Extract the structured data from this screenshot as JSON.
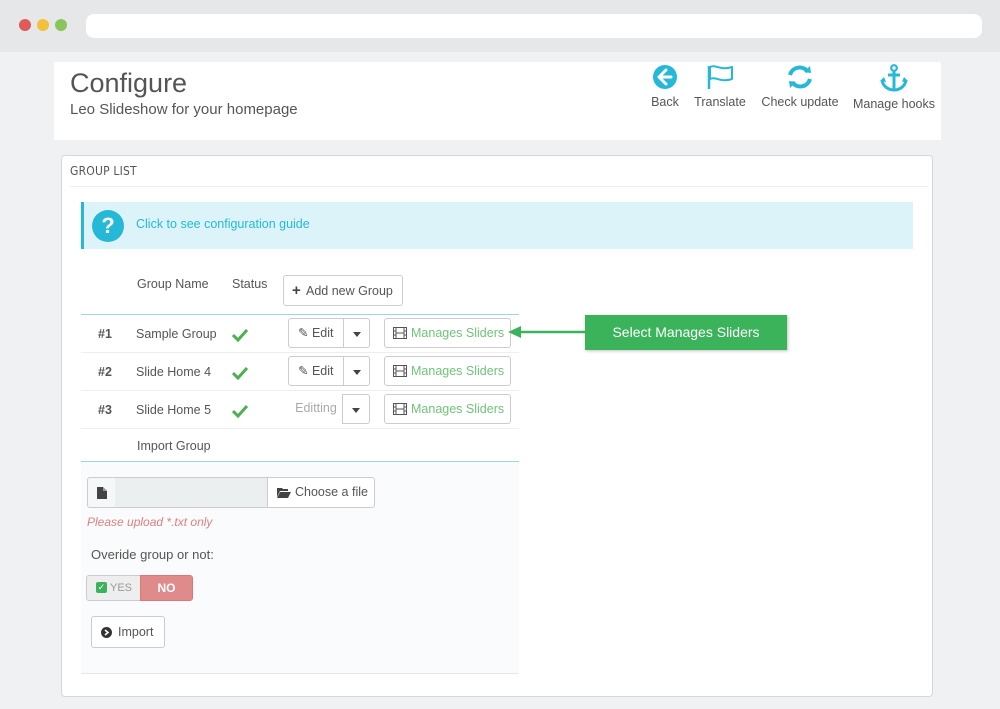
{
  "header": {
    "title": "Configure",
    "subtitle": "Leo Slideshow for your homepage",
    "toolbar": [
      {
        "label": "Back",
        "icon": "back-arrow-circle-icon"
      },
      {
        "label": "Translate",
        "icon": "flag-icon"
      },
      {
        "label": "Check update",
        "icon": "refresh-icon"
      },
      {
        "label": "Manage hooks",
        "icon": "anchor-icon"
      }
    ]
  },
  "panel": {
    "heading": "GROUP LIST",
    "alert_link": "Click to see configuration guide",
    "columns": {
      "name": "Group Name",
      "status": "Status"
    },
    "add_button": "Add new Group",
    "rows": [
      {
        "num": "#1",
        "name": "Sample Group",
        "edit": "Edit",
        "manage": "Manages Sliders"
      },
      {
        "num": "#2",
        "name": "Slide Home 4",
        "edit": "Edit",
        "manage": "Manages Sliders"
      },
      {
        "num": "#3",
        "name": "Slide Home 5",
        "edit": "Editting",
        "manage": "Manages Sliders"
      }
    ],
    "import_title": "Import Group"
  },
  "callout": "Select Manages Sliders",
  "import": {
    "choose_file": "Choose a file",
    "hint": "Please upload *.txt only",
    "override_label": "Overide group or not:",
    "yes": "YES",
    "no": "NO",
    "import_button": "Import"
  },
  "colors": {
    "accent": "#25b9d7",
    "success": "#72c279",
    "callout": "#3bb35b",
    "danger": "#e08b8b"
  }
}
